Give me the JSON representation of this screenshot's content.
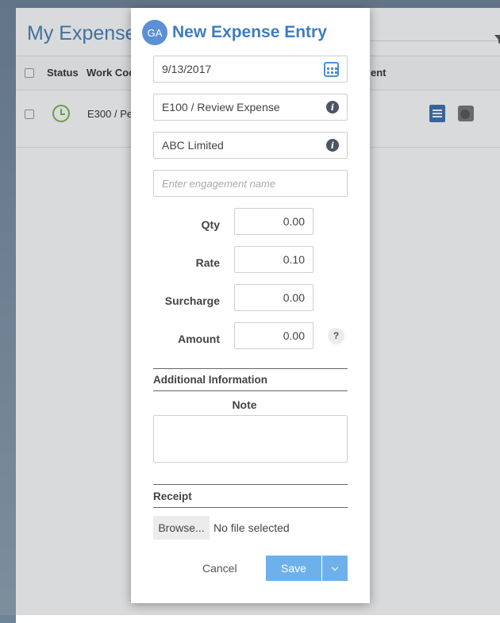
{
  "background": {
    "title": "My Expense",
    "columns": {
      "status": "Status",
      "work_code": "Work Coc",
      "trailing": "ent"
    },
    "row": {
      "work_code": "E300 / Pe"
    }
  },
  "modal": {
    "avatar_initials": "GA",
    "title": "New Expense Entry",
    "date": "9/13/2017",
    "work_code": "E100 / Review Expense",
    "client": "ABC Limited",
    "engagement_placeholder": "Enter engagement name",
    "fields": {
      "qty": {
        "label": "Qty",
        "value": "0.00"
      },
      "rate": {
        "label": "Rate",
        "value": "0.10"
      },
      "surcharge": {
        "label": "Surcharge",
        "value": "0.00"
      },
      "amount": {
        "label": "Amount",
        "value": "0.00"
      }
    },
    "help_glyph": "?",
    "additional_info_title": "Additional Information",
    "note_label": "Note",
    "note_value": "",
    "receipt_title": "Receipt",
    "browse_label": "Browse...",
    "no_file_text": "No file selected",
    "cancel_label": "Cancel",
    "save_label": "Save"
  },
  "colors": {
    "accent": "#3f7cc0",
    "save_button": "#6eb1ea",
    "status_ok": "#7ab648"
  }
}
